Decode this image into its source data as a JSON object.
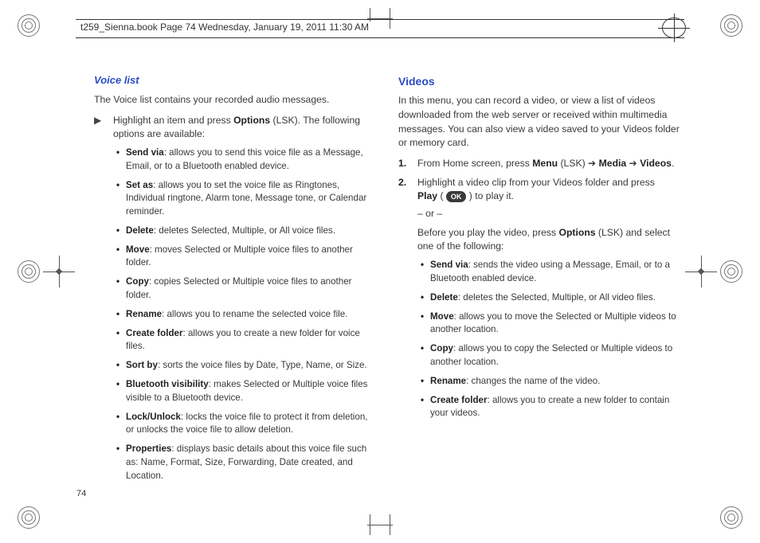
{
  "header": {
    "text": "t259_Sienna.book  Page 74  Wednesday, January 19, 2011  11:30 AM"
  },
  "page_number": "74",
  "left": {
    "heading": "Voice list",
    "intro": "The Voice list contains your recorded audio messages.",
    "step_marker": "▶",
    "step_text_pre": "Highlight an item and press ",
    "step_bold1": "Options",
    "step_text_post": " (LSK). The following options are available:",
    "bullets": [
      {
        "b": "Send via",
        "t": ": allows you to send this voice file as a Message, Email, or to a Bluetooth enabled device."
      },
      {
        "b": "Set as",
        "t": ": allows you to set the voice file as Ringtones, Individual ringtone, Alarm tone, Message tone, or Calendar reminder."
      },
      {
        "b": "Delete",
        "t": ": deletes Selected, Multiple, or All voice files."
      },
      {
        "b": "Move",
        "t": ": moves Selected or Multiple voice files to another folder."
      },
      {
        "b": "Copy",
        "t": ": copies Selected or Multiple voice files to another folder."
      },
      {
        "b": "Rename",
        "t": ": allows you to rename the selected voice file."
      },
      {
        "b": "Create folder",
        "t": ": allows you to create a new folder for voice files."
      },
      {
        "b": "Sort by",
        "t": ": sorts the voice files by Date, Type, Name, or Size."
      },
      {
        "b": "Bluetooth visibility",
        "t": ": makes Selected or Multiple voice files visible to a Bluetooth device."
      },
      {
        "b": "Lock/Unlock",
        "t": ": locks the voice file to protect it from deletion, or unlocks the voice file to allow deletion."
      },
      {
        "b": "Properties",
        "t": ": displays basic details about this voice file such as: Name, Format, Size, Forwarding, Date created, and Location."
      }
    ]
  },
  "right": {
    "heading": "Videos",
    "intro": "In this menu, you can record a video, or view a list of videos downloaded from the web server or received within multimedia messages. You can also view a video saved to your Videos folder or memory card.",
    "step1_num": "1.",
    "step1_pre": "From Home screen, press ",
    "step1_b1": "Menu",
    "step1_mid1": " (LSK) ",
    "arrow": "➔",
    "step1_b2": "Media",
    "step1_b3": "Videos",
    "step1_end": ".",
    "step2_num": "2.",
    "step2_line1_pre": "Highlight a video clip from your Videos folder and press ",
    "step2_line2_b": "Play",
    "step2_line2_open": " ( ",
    "ok_label": "OK",
    "step2_line2_close": " ) to play it.",
    "or": "– or –",
    "step2_line3_pre": "Before you play the video, press ",
    "step2_line3_b": "Options",
    "step2_line3_post": " (LSK) and select one of the following:",
    "bullets": [
      {
        "b": "Send via",
        "t": ": sends the video using a Message, Email, or to a Bluetooth enabled device."
      },
      {
        "b": "Delete",
        "t": ": deletes the Selected, Multiple, or All video files."
      },
      {
        "b": "Move",
        "t": ": allows you to move the Selected or Multiple videos to another location."
      },
      {
        "b": "Copy",
        "t": ": allows you to copy the Selected or Multiple videos to another location."
      },
      {
        "b": "Rename",
        "t": ": changes the name of the video."
      },
      {
        "b": "Create folder",
        "t": ": allows you to create a new folder to contain your videos."
      }
    ]
  }
}
